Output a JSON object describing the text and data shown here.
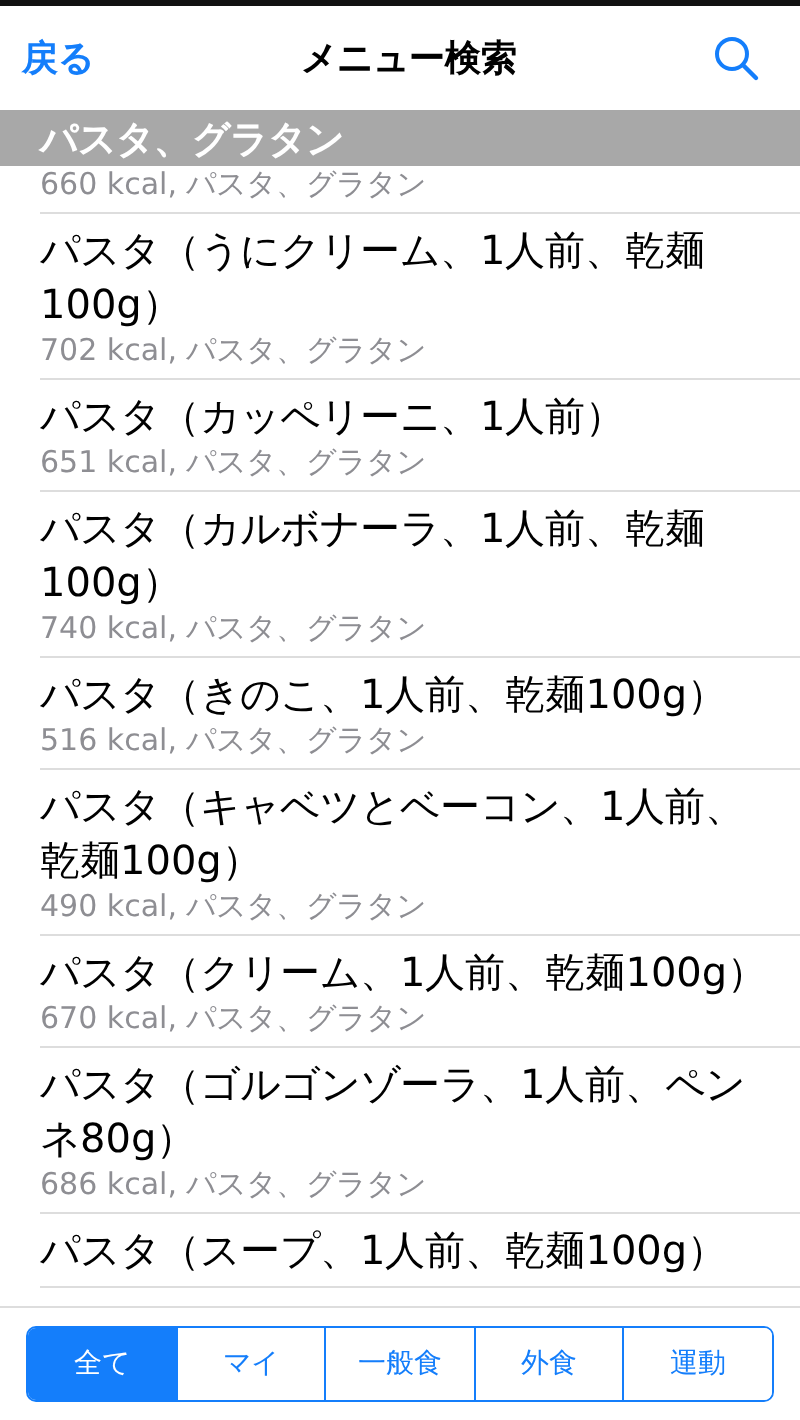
{
  "nav": {
    "back": "戻る",
    "title": "メニュー検索"
  },
  "section_header": "パスタ、グラタン",
  "items": [
    {
      "subtitle": "660 kcal, パスタ、グラタン"
    },
    {
      "title": "パスタ（うにクリーム、1人前、乾麺100g）",
      "subtitle": "702 kcal, パスタ、グラタン"
    },
    {
      "title": "パスタ（カッペリーニ、1人前）",
      "subtitle": "651 kcal, パスタ、グラタン"
    },
    {
      "title": "パスタ（カルボナーラ、1人前、乾麺100g）",
      "subtitle": "740 kcal, パスタ、グラタン"
    },
    {
      "title": "パスタ（きのこ、1人前、乾麺100g）",
      "subtitle": "516 kcal, パスタ、グラタン"
    },
    {
      "title": "パスタ（キャベツとベーコン、1人前、乾麺100g）",
      "subtitle": "490 kcal, パスタ、グラタン"
    },
    {
      "title": "パスタ（クリーム、1人前、乾麺100g）",
      "subtitle": "670 kcal, パスタ、グラタン"
    },
    {
      "title": "パスタ（ゴルゴンゾーラ、1人前、ペンネ80g）",
      "subtitle": "686 kcal, パスタ、グラタン"
    },
    {
      "title": "パスタ（スープ、1人前、乾麺100g）"
    }
  ],
  "tabs": [
    {
      "label": "全て",
      "selected": true
    },
    {
      "label": "マイ",
      "selected": false
    },
    {
      "label": "一般食",
      "selected": false
    },
    {
      "label": "外食",
      "selected": false
    },
    {
      "label": "運動",
      "selected": false
    }
  ]
}
